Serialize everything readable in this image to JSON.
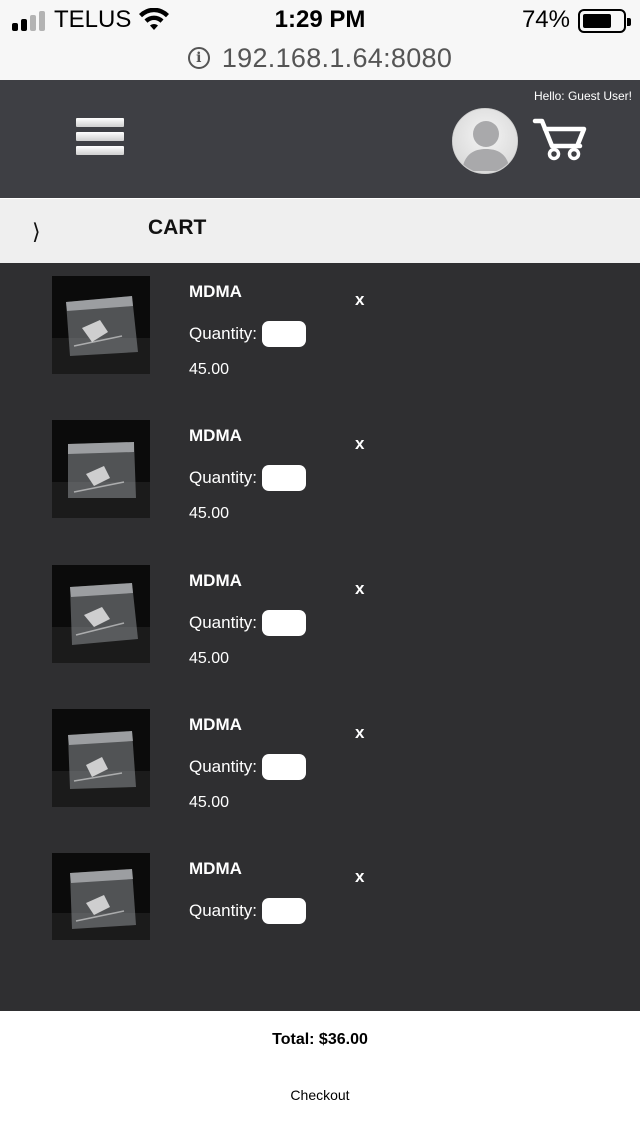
{
  "status_bar": {
    "carrier": "TELUS",
    "time": "1:29 PM",
    "battery_percent": "74%",
    "battery_level": 0.74,
    "signal_bars_filled": 2,
    "signal_bars_total": 4,
    "icons": [
      "signal-icon",
      "wifi-icon",
      "battery-icon"
    ]
  },
  "browser": {
    "url": "192.168.1.64:8080",
    "info_icon": "i"
  },
  "header": {
    "greeting": "Hello: Guest User!",
    "icons": [
      "hamburger-menu-icon",
      "avatar-icon",
      "cart-icon"
    ],
    "background": "#3e3f44"
  },
  "breadcrumb": {
    "arrow": "⟩",
    "title": "CART"
  },
  "cart": {
    "background": "#2f2f31",
    "remove_label": "x",
    "quantity_label": "Quantity:",
    "items": [
      {
        "name": "MDMA",
        "price": "45.00",
        "quantity": ""
      },
      {
        "name": "MDMA",
        "price": "45.00",
        "quantity": ""
      },
      {
        "name": "MDMA",
        "price": "45.00",
        "quantity": ""
      },
      {
        "name": "MDMA",
        "price": "45.00",
        "quantity": ""
      },
      {
        "name": "MDMA",
        "price": "",
        "quantity": ""
      }
    ]
  },
  "footer": {
    "total": "Total: $36.00",
    "checkout_label": "Checkout"
  }
}
